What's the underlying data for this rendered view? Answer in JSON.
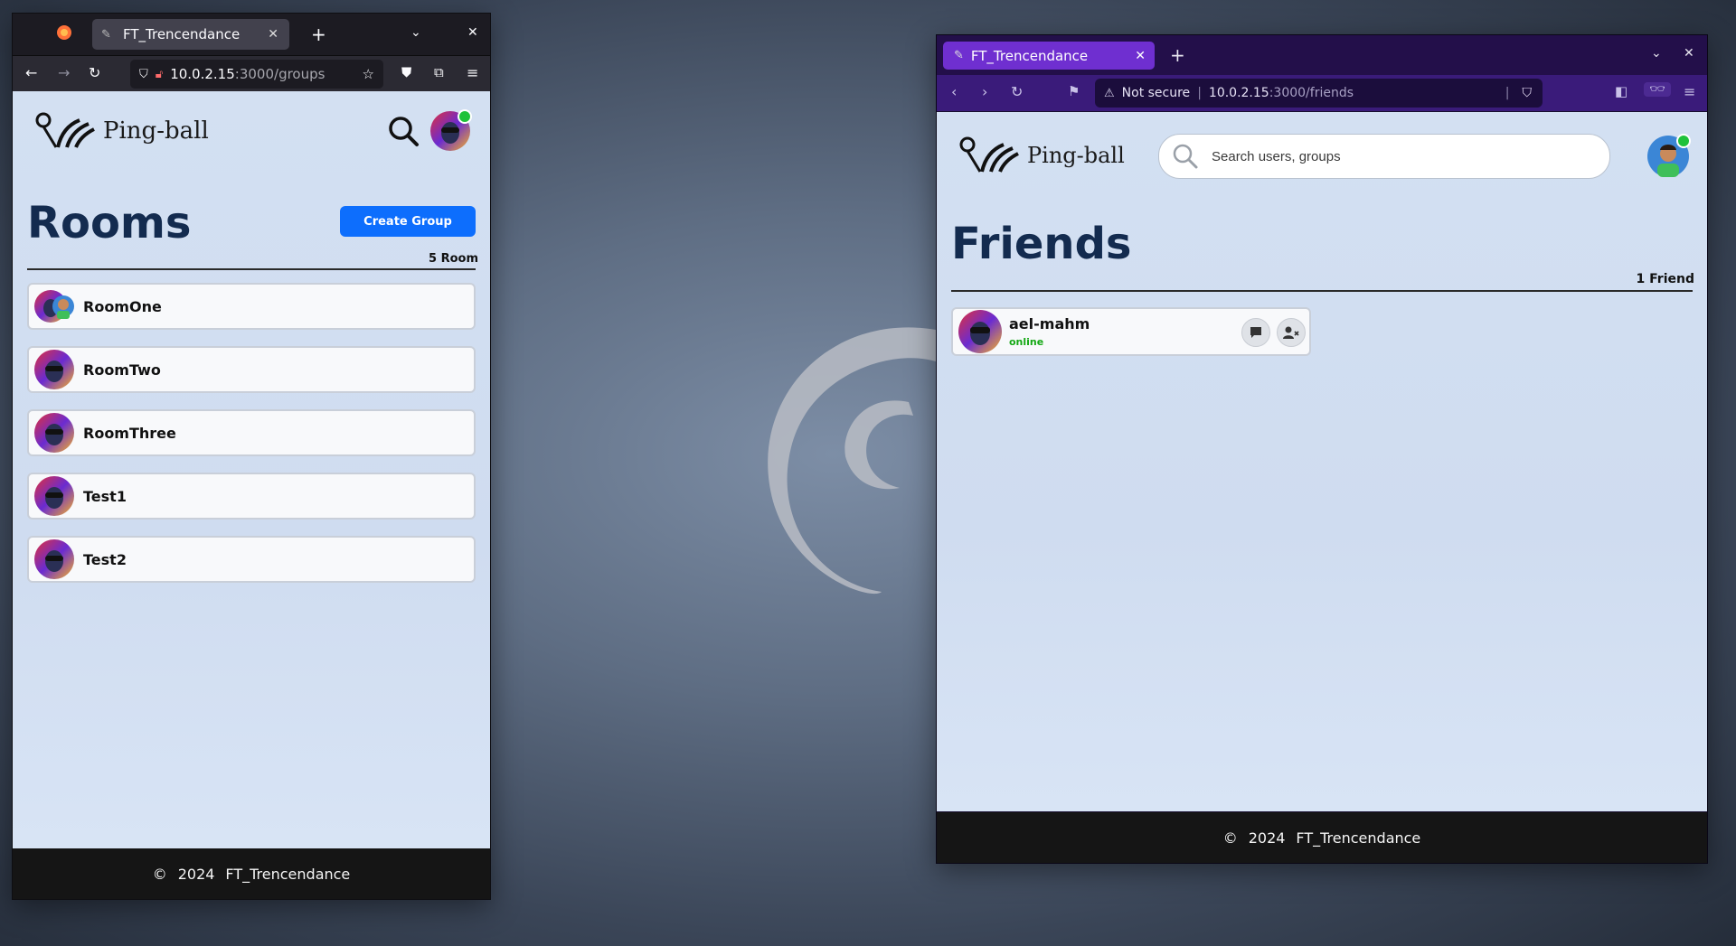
{
  "left_window": {
    "tab_title": "FT_Trencendance",
    "url_host": "10.0.2.15",
    "url_path": ":3000/groups",
    "app": {
      "logo_text": "Ping-ball",
      "page_title": "Rooms",
      "create_button": "Create Group",
      "count_label": "5 Room",
      "rooms": [
        {
          "name": "RoomOne"
        },
        {
          "name": "RoomTwo"
        },
        {
          "name": "RoomThree"
        },
        {
          "name": "Test1"
        },
        {
          "name": "Test2"
        }
      ]
    },
    "footer": {
      "copyright": "©",
      "year": "2024",
      "name": "FT_Trencendance"
    }
  },
  "right_window": {
    "tab_title": "FT_Trencendance",
    "security_label": "Not secure",
    "url_host": "10.0.2.15",
    "url_path": ":3000/friends",
    "app": {
      "logo_text": "Ping-ball",
      "search_placeholder": "Search users, groups",
      "page_title": "Friends",
      "count_label": "1 Friend",
      "friends": [
        {
          "name": "ael-mahm",
          "status": "online"
        }
      ]
    },
    "footer": {
      "copyright": "©",
      "year": "2024",
      "name": "FT_Trencendance"
    }
  },
  "colors": {
    "accent": "#0d6efd",
    "title": "#132b4f",
    "online": "#1fc23a",
    "brave_tab": "#6f2fd0"
  }
}
